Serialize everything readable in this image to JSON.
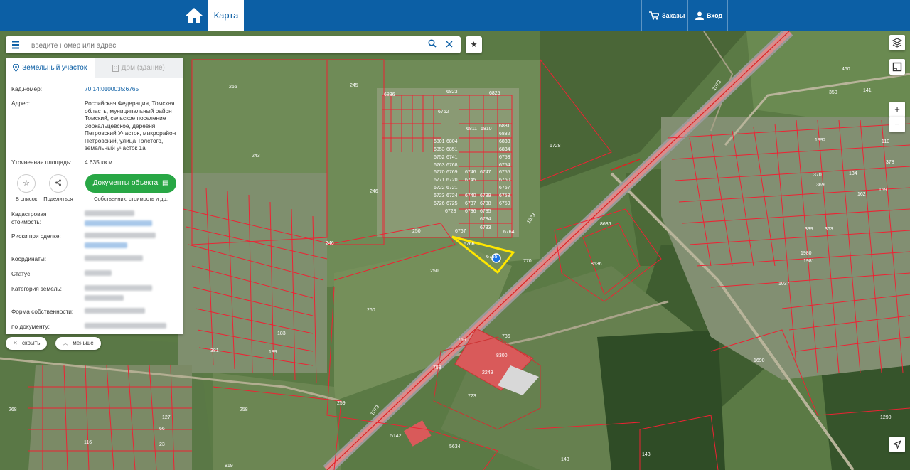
{
  "header": {
    "tab_map": "Карта",
    "orders_label": "Заказы",
    "login_label": "Вход"
  },
  "search": {
    "placeholder": "введите номер или адрес"
  },
  "panel": {
    "tab_land": "Земельный участок",
    "tab_building": "Дом (здание)",
    "cad_number_label": "Кад.номер:",
    "cad_number_value": "70:14:0100035:6765",
    "address_label": "Адрес:",
    "address_value": "Российская Федерация, Томская область, муниципальный район Томский, сельское поселение Зоркальцевское, деревня Петровский Участок, микрорайон Петровский, улица Толстого, земельный участок 1а",
    "area_label": "Уточненная площадь:",
    "area_value": "4 635 кв.м",
    "to_list": "В список",
    "share": "Поделиться",
    "docs_button": "Документы объекта",
    "docs_sub": "Собственник, стоимость и др.",
    "cad_cost_label": "Кадастровая стоимость:",
    "risks_label": "Риски при сделке:",
    "coords_label": "Координаты:",
    "status_label": "Статус:",
    "category_label": "Категория земель:",
    "ownership_label": "Форма собственности:",
    "by_doc_label": "по документу:"
  },
  "pills": {
    "hide": "скрыть",
    "less": "меньше"
  },
  "map_labels": [
    {
      "t": "265"
    },
    {
      "t": "245"
    },
    {
      "t": "243"
    },
    {
      "t": "246"
    },
    {
      "t": "250"
    },
    {
      "t": "250"
    },
    {
      "t": "246"
    },
    {
      "t": "260"
    },
    {
      "t": "259"
    },
    {
      "t": "258"
    },
    {
      "t": "268"
    },
    {
      "t": "1728"
    },
    {
      "t": "8636"
    },
    {
      "t": "8636"
    },
    {
      "t": "8300"
    },
    {
      "t": "2249"
    },
    {
      "t": "769"
    },
    {
      "t": "736"
    },
    {
      "t": "758"
    },
    {
      "t": "723"
    },
    {
      "t": "5142"
    },
    {
      "t": "5634"
    },
    {
      "t": "143"
    },
    {
      "t": "143"
    },
    {
      "t": "1073"
    },
    {
      "t": "1073"
    },
    {
      "t": "1073"
    },
    {
      "t": "1037"
    },
    {
      "t": "6766"
    },
    {
      "t": "6765"
    },
    {
      "t": "6767"
    },
    {
      "t": "6764"
    },
    {
      "t": "770"
    },
    {
      "t": "819"
    },
    {
      "t": "381"
    },
    {
      "t": "6836"
    },
    {
      "t": "6823"
    },
    {
      "t": "6825"
    },
    {
      "t": "6811"
    },
    {
      "t": "6810"
    },
    {
      "t": "6831"
    },
    {
      "t": "6832"
    },
    {
      "t": "6833"
    },
    {
      "t": "6834"
    },
    {
      "t": "6801"
    },
    {
      "t": "6804"
    },
    {
      "t": "6853"
    },
    {
      "t": "6851"
    },
    {
      "t": "6746"
    },
    {
      "t": "6747"
    },
    {
      "t": "6745"
    },
    {
      "t": "6740"
    },
    {
      "t": "6739"
    },
    {
      "t": "6737"
    },
    {
      "t": "6738"
    },
    {
      "t": "6736"
    },
    {
      "t": "6735"
    },
    {
      "t": "6734"
    },
    {
      "t": "6733"
    },
    {
      "t": "6728"
    },
    {
      "t": "6726"
    },
    {
      "t": "6725"
    },
    {
      "t": "6723"
    },
    {
      "t": "6724"
    },
    {
      "t": "6722"
    },
    {
      "t": "6721"
    },
    {
      "t": "6771"
    },
    {
      "t": "6720"
    },
    {
      "t": "6770"
    },
    {
      "t": "6769"
    },
    {
      "t": "6763"
    },
    {
      "t": "6768"
    },
    {
      "t": "6752"
    },
    {
      "t": "6741"
    },
    {
      "t": "6760"
    },
    {
      "t": "6759"
    },
    {
      "t": "6758"
    },
    {
      "t": "6757"
    },
    {
      "t": "6755"
    },
    {
      "t": "6754"
    },
    {
      "t": "6753"
    },
    {
      "t": "6762"
    },
    {
      "t": "460"
    },
    {
      "t": "350"
    },
    {
      "t": "141"
    },
    {
      "t": "110"
    },
    {
      "t": "378"
    },
    {
      "t": "134"
    },
    {
      "t": "162"
    },
    {
      "t": "159"
    },
    {
      "t": "339"
    },
    {
      "t": "363"
    },
    {
      "t": "370"
    },
    {
      "t": "369"
    },
    {
      "t": "1980"
    },
    {
      "t": "1981"
    },
    {
      "t": "1690"
    },
    {
      "t": "1992"
    },
    {
      "t": "1290"
    },
    {
      "t": "189"
    },
    {
      "t": "183"
    },
    {
      "t": "127"
    },
    {
      "t": "66"
    },
    {
      "t": "23"
    },
    {
      "t": "116"
    }
  ]
}
